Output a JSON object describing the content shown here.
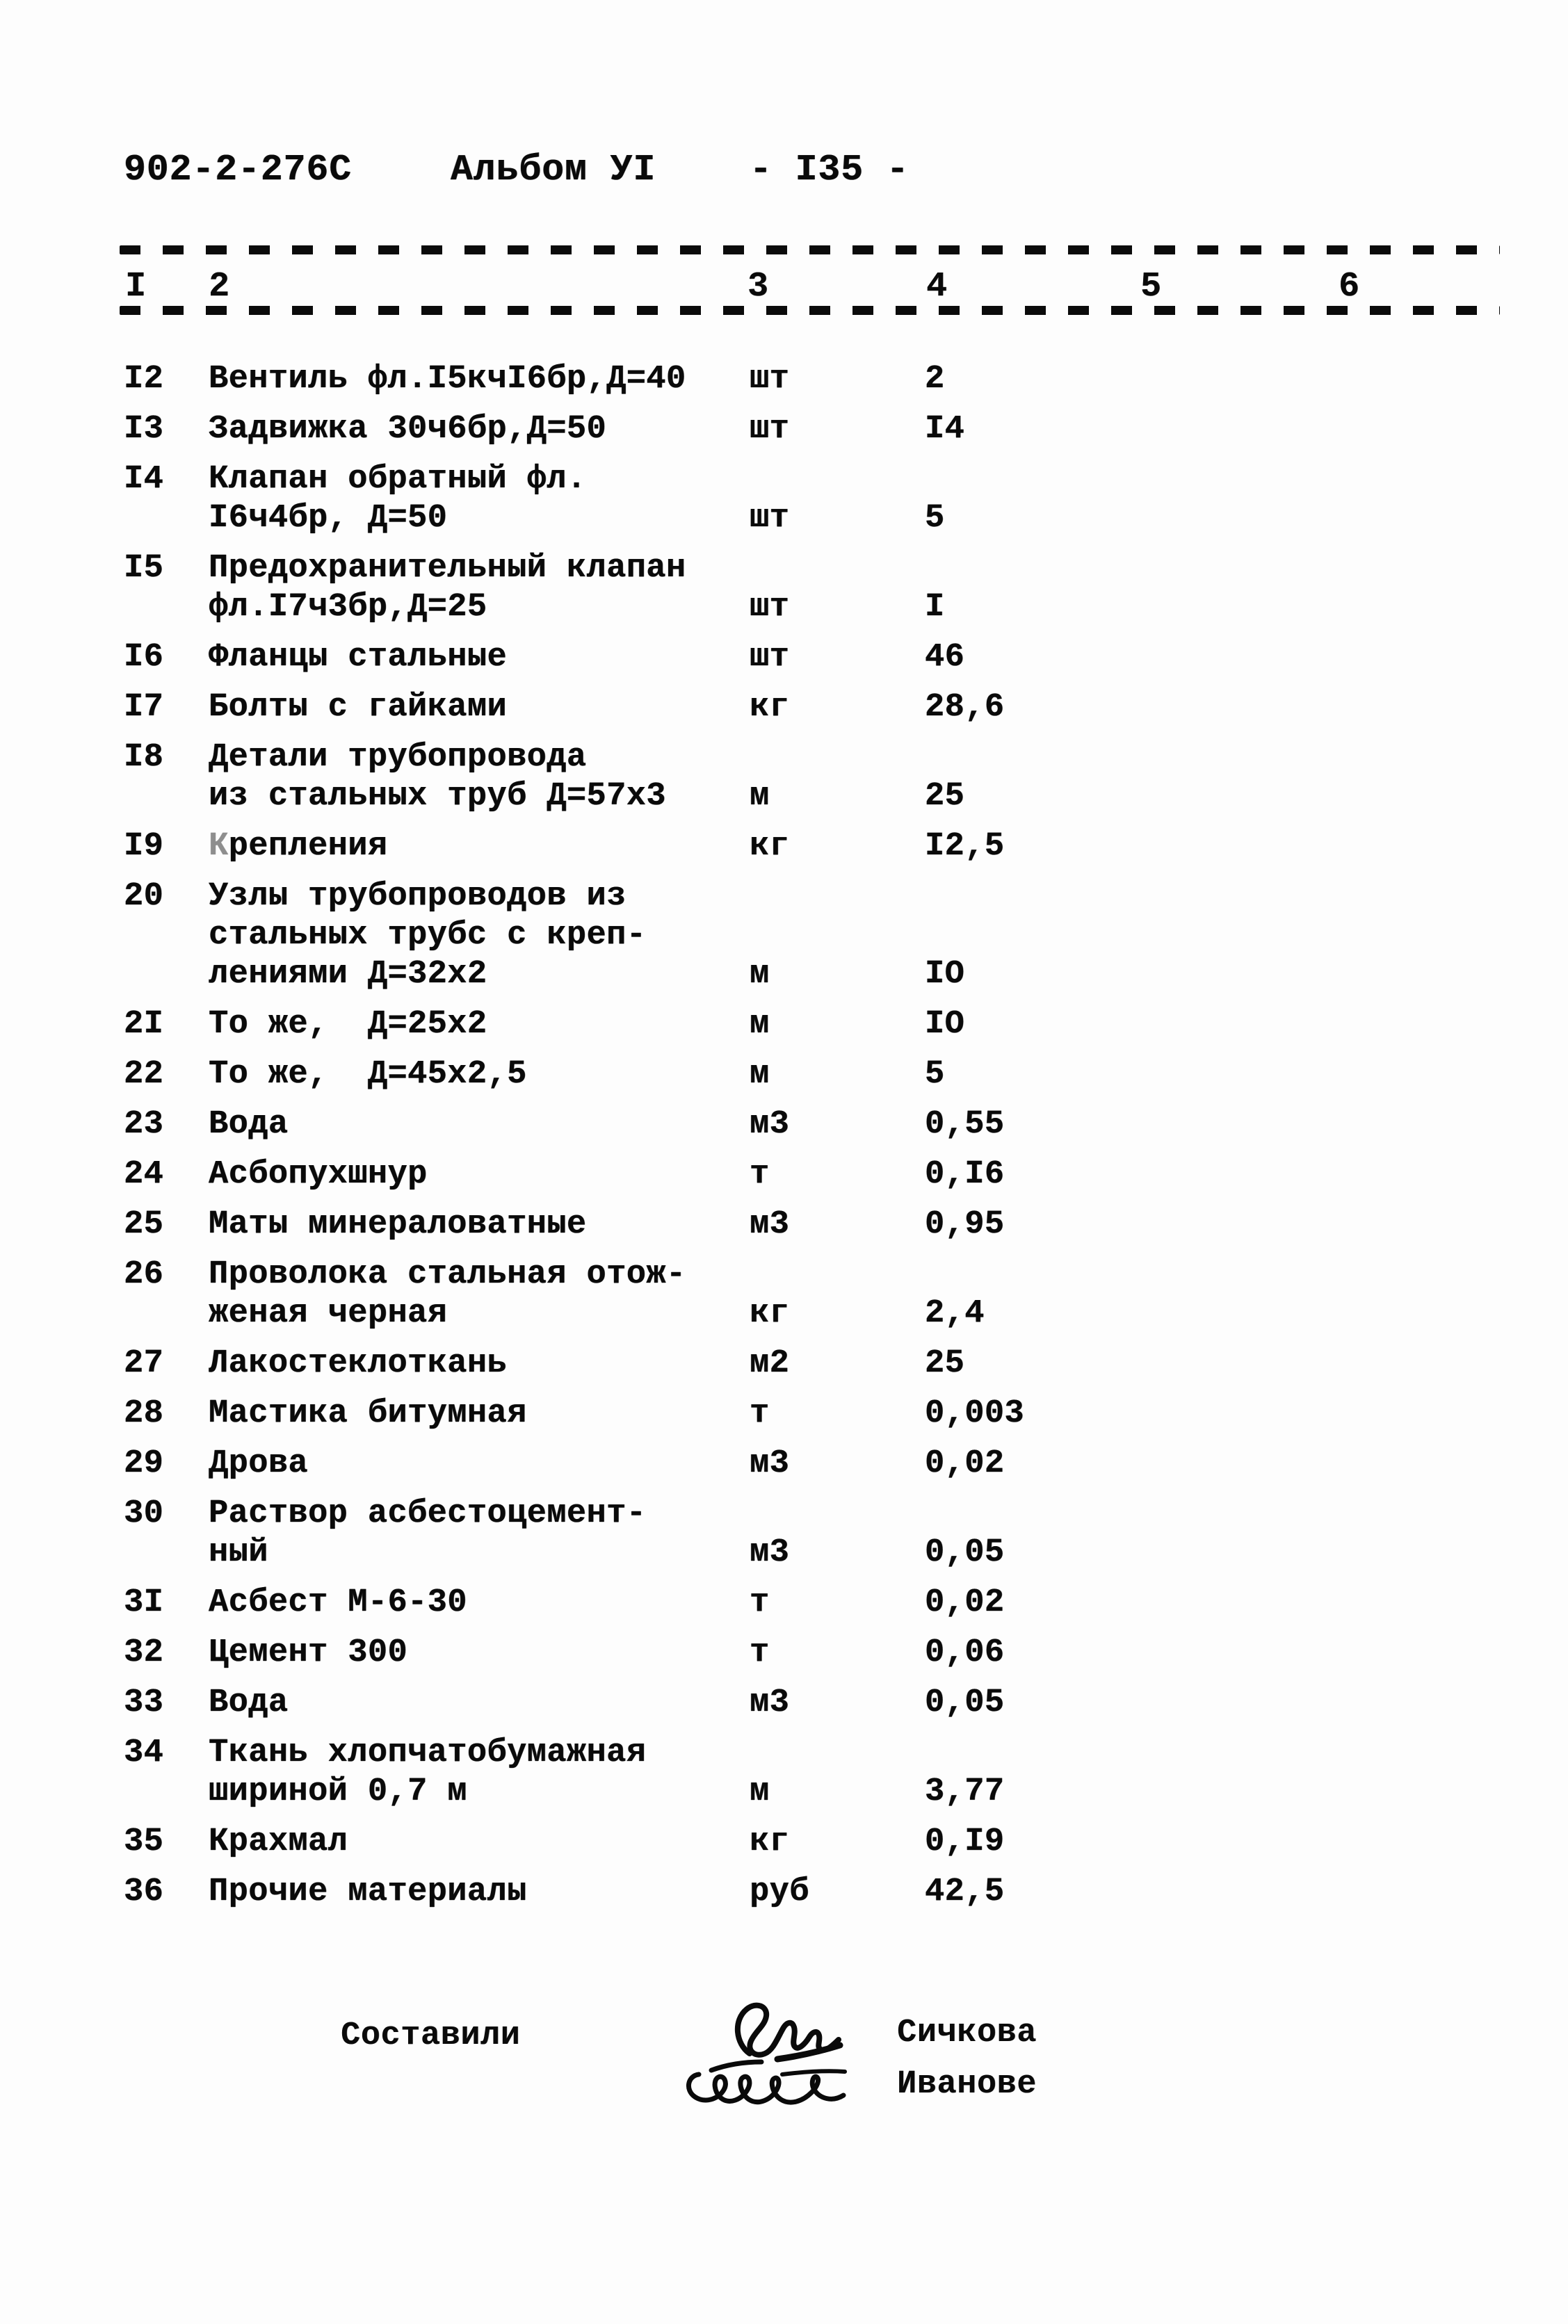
{
  "header": {
    "doc_code": "902-2-276С",
    "album": "Альбом УI",
    "page_number": "- I35 -"
  },
  "table": {
    "column_headers": [
      "I",
      "2",
      "3",
      "4",
      "5",
      "6"
    ],
    "rows": [
      {
        "no": "I2",
        "name": "Вентиль фл.I5кчI6бр,Д=40",
        "name2": "",
        "name3": "",
        "unit": "шт",
        "qty": "2"
      },
      {
        "no": "I3",
        "name": "Задвижка 30ч6бр,Д=50",
        "name2": "",
        "name3": "",
        "unit": "шт",
        "qty": "I4"
      },
      {
        "no": "I4",
        "name": "Клапан обратный фл.",
        "name2": "I6ч4бр, Д=50",
        "name3": "",
        "unit": "шт",
        "qty": "5"
      },
      {
        "no": "I5",
        "name": "Предохранительный клапан",
        "name2": "фл.I7ч3бр,Д=25",
        "name3": "",
        "unit": "шт",
        "qty": "I"
      },
      {
        "no": "I6",
        "name": "Фланцы стальные",
        "name2": "",
        "name3": "",
        "unit": "шт",
        "qty": "46"
      },
      {
        "no": "I7",
        "name": "Болты с гайками",
        "name2": "",
        "name3": "",
        "unit": "кг",
        "qty": "28,6"
      },
      {
        "no": "I8",
        "name": "Детали трубопровода",
        "name2": "из стальных труб Д=57х3",
        "name3": "",
        "unit": "м",
        "qty": "25"
      },
      {
        "no": "I9",
        "name": "Крепления",
        "name2": "",
        "name3": "",
        "unit": "кг",
        "qty": "I2,5"
      },
      {
        "no": "20",
        "name": "Узлы трубопроводов из",
        "name2": "стальных трубс с креп-",
        "name3": "лениями Д=32х2",
        "unit": "м",
        "qty": "IO"
      },
      {
        "no": "2I",
        "name": "То же,  Д=25х2",
        "name2": "",
        "name3": "",
        "unit": "м",
        "qty": "IO"
      },
      {
        "no": "22",
        "name": "То же,  Д=45х2,5",
        "name2": "",
        "name3": "",
        "unit": "м",
        "qty": "5"
      },
      {
        "no": "23",
        "name": "Вода",
        "name2": "",
        "name3": "",
        "unit": "м3",
        "qty": "0,55"
      },
      {
        "no": "24",
        "name": "Асбопухшнур",
        "name2": "",
        "name3": "",
        "unit": "т",
        "qty": "0,I6"
      },
      {
        "no": "25",
        "name": "Маты минераловатные",
        "name2": "",
        "name3": "",
        "unit": "м3",
        "qty": "0,95"
      },
      {
        "no": "26",
        "name": "Проволока стальная отож-",
        "name2": "женая черная",
        "name3": "",
        "unit": "кг",
        "qty": "2,4"
      },
      {
        "no": "27",
        "name": "Лакостеклоткань",
        "name2": "",
        "name3": "",
        "unit": "м2",
        "qty": "25"
      },
      {
        "no": "28",
        "name": "Мастика битумная",
        "name2": "",
        "name3": "",
        "unit": "т",
        "qty": "0,003"
      },
      {
        "no": "29",
        "name": "Дрова",
        "name2": "",
        "name3": "",
        "unit": "м3",
        "qty": "0,02"
      },
      {
        "no": "30",
        "name": "Раствор асбестоцемент-",
        "name2": "ный",
        "name3": "",
        "unit": "м3",
        "qty": "0,05"
      },
      {
        "no": "3I",
        "name": "Асбест М-6-30",
        "name2": "",
        "name3": "",
        "unit": "т",
        "qty": "0,02"
      },
      {
        "no": "32",
        "name": "Цемент 300",
        "name2": "",
        "name3": "",
        "unit": "т",
        "qty": "0,06"
      },
      {
        "no": "33",
        "name": "Вода",
        "name2": "",
        "name3": "",
        "unit": "м3",
        "qty": "0,05"
      },
      {
        "no": "34",
        "name": "Ткань хлопчатобумажная",
        "name2": "шириной 0,7 м",
        "name3": "",
        "unit": "м",
        "qty": "3,77"
      },
      {
        "no": "35",
        "name": "Крахмал",
        "name2": "",
        "name3": "",
        "unit": "кг",
        "qty": "0,I9"
      },
      {
        "no": "36",
        "name": "Прочие материалы",
        "name2": "",
        "name3": "",
        "unit": "руб",
        "qty": "42,5"
      }
    ]
  },
  "footer": {
    "compiled_label": "Составили",
    "signers": [
      "Сичкова",
      "Иванове"
    ]
  }
}
